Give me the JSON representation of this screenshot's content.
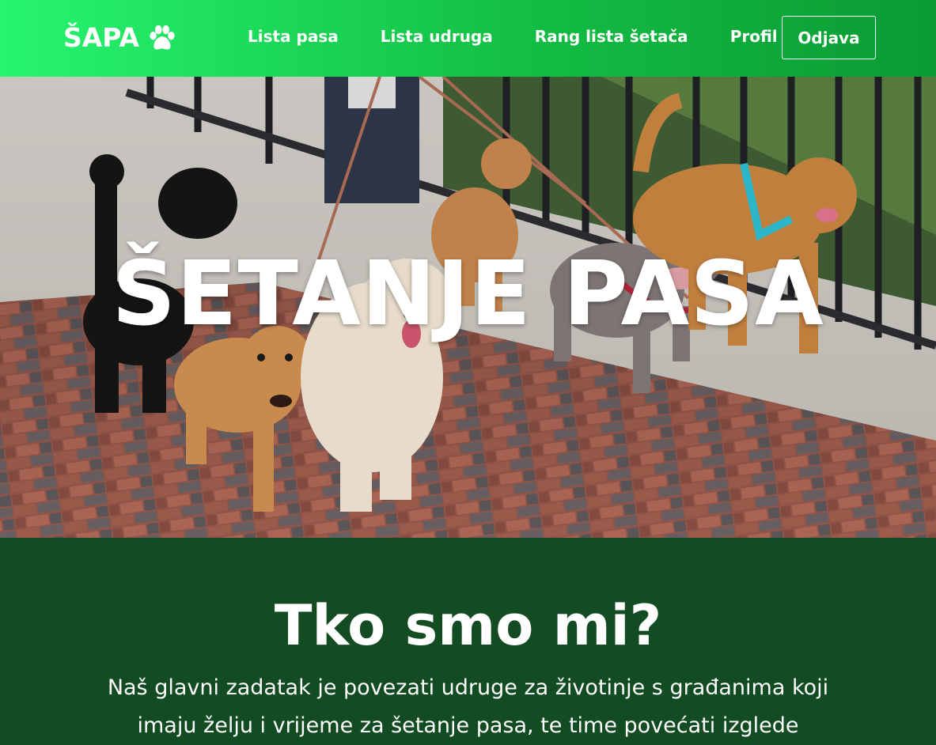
{
  "brand": {
    "name": "ŠAPA",
    "icon": "paw-icon"
  },
  "nav": {
    "items": [
      {
        "label": "Lista pasa"
      },
      {
        "label": "Lista udruga"
      },
      {
        "label": "Rang lista šetača"
      },
      {
        "label": "Profil"
      }
    ],
    "logout_label": "Odjava"
  },
  "hero": {
    "title": "ŠETANJE PASA"
  },
  "about": {
    "title": "Tko smo mi?",
    "text": "Naš glavni zadatak je povezati udruge za životinje s građanima koji imaju želju i vrijeme za šetanje pasa, te time povećati izglede"
  },
  "colors": {
    "nav_gradient_start": "#27f56f",
    "nav_gradient_end": "#0b9a34",
    "section_bg": "#134b23",
    "text": "#ffffff"
  }
}
